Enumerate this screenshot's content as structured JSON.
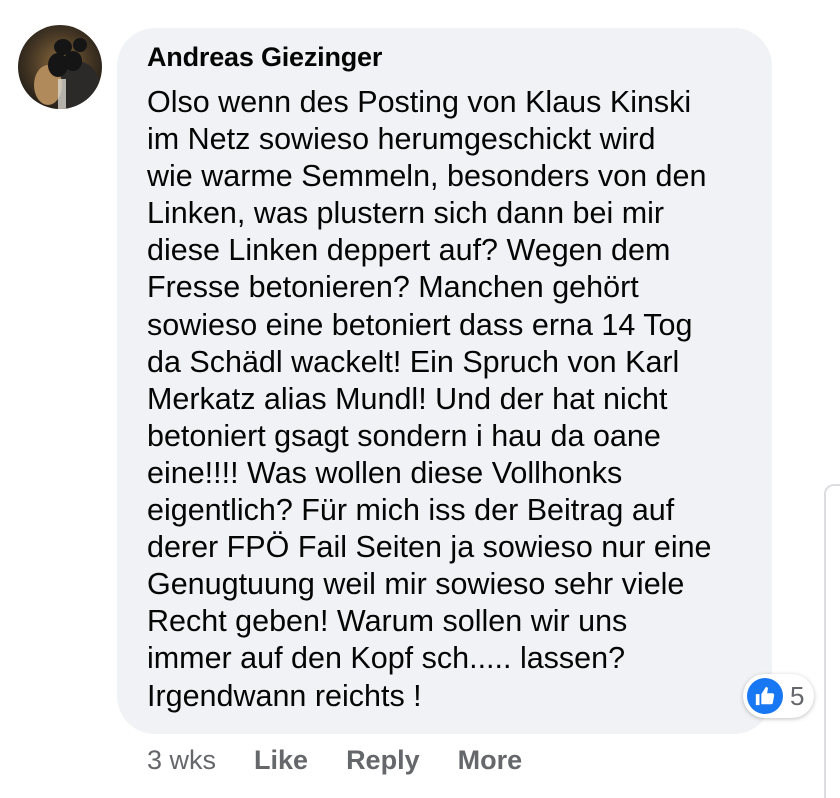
{
  "comment": {
    "author": "Andreas Giezinger",
    "text_lines": [
      "Olso wenn des Posting von Klaus Kinski",
      "im Netz sowieso herumgeschickt wird",
      "wie warme Semmeln, besonders von den",
      "Linken, was plustern sich dann bei mir",
      "diese Linken deppert auf? Wegen dem",
      "Fresse betonieren? Manchen gehört",
      "sowieso eine betoniert dass erna 14 Tog",
      "da Schädl wackelt! Ein Spruch von Karl",
      "Merkatz alias Mundl! Und der hat nicht",
      "betoniert gsagt sondern i hau da oane",
      "eine!!!! Was wollen diese Vollhonks",
      "eigentlich? Für mich iss der Beitrag auf",
      "derer FPÖ Fail Seiten ja sowieso nur eine",
      "Genugtuung weil mir sowieso sehr viele",
      "Recht geben! Warum sollen wir uns",
      "immer auf den Kopf sch..... lassen?",
      "Irgendwann reichts !"
    ],
    "reaction": {
      "icon": "thumbs-up-icon",
      "count": "5",
      "color": "#1877f2"
    }
  },
  "actions": {
    "timestamp": "3 wks",
    "like_label": "Like",
    "reply_label": "Reply",
    "more_label": "More"
  },
  "colors": {
    "bubble_background": "#f0f2f5",
    "text": "#050505",
    "secondary_text": "#65676b"
  }
}
